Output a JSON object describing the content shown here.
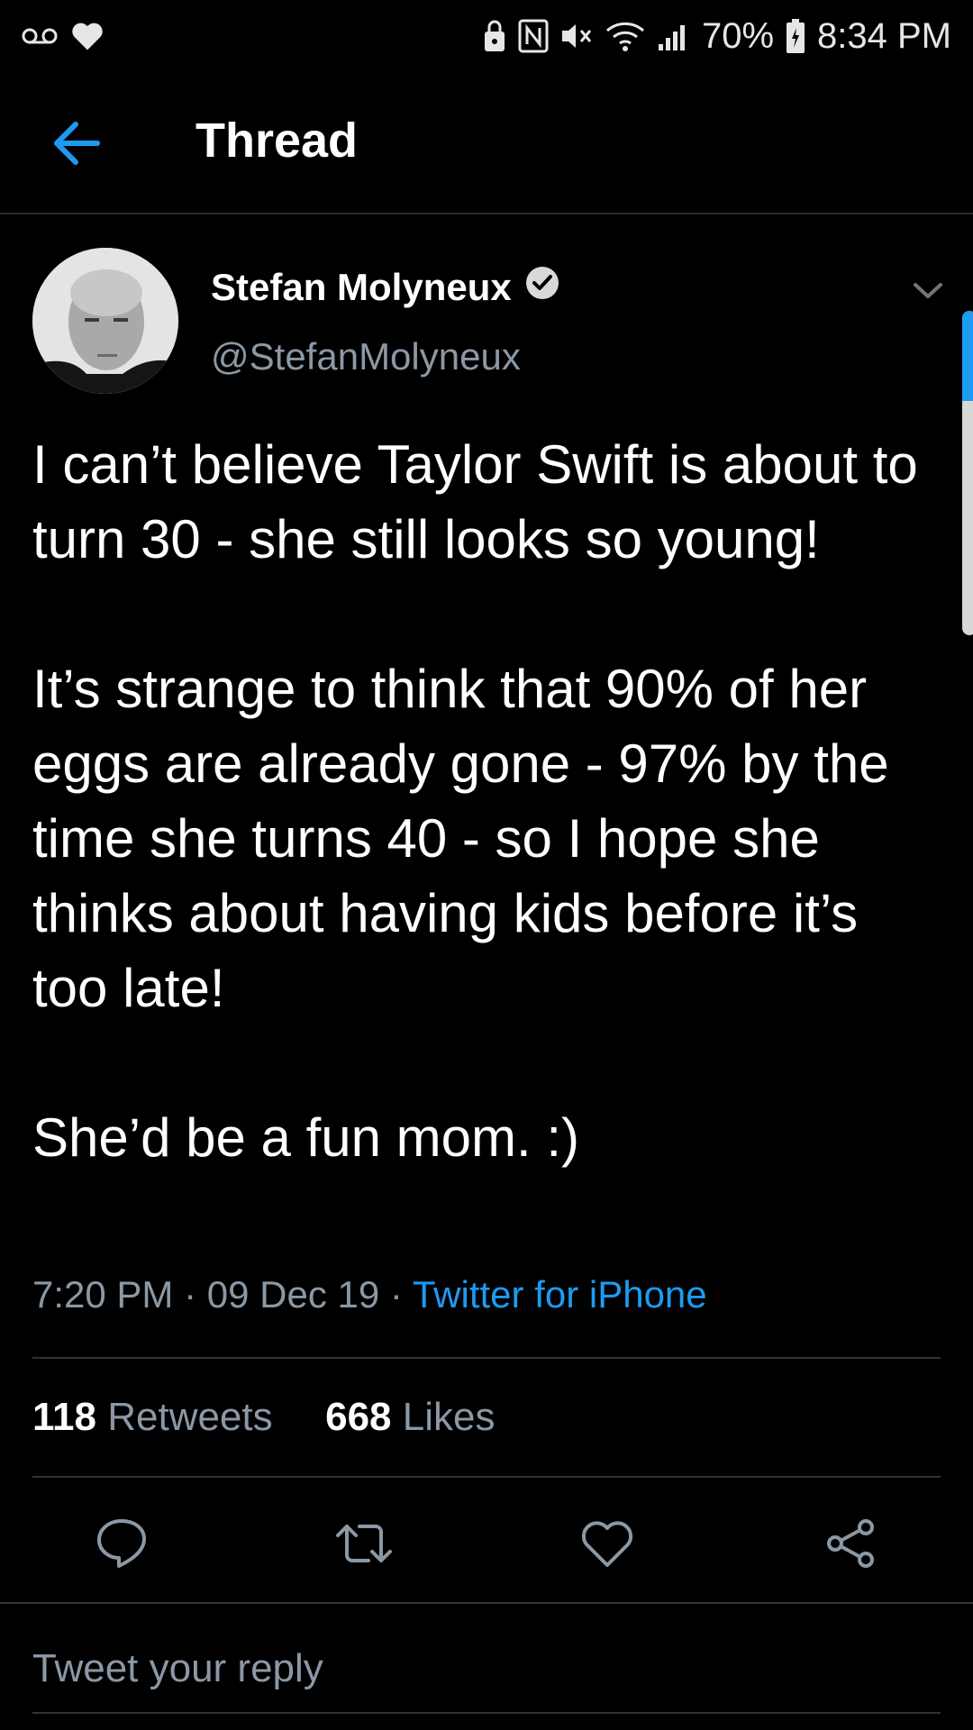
{
  "status_bar": {
    "battery": "70%",
    "time": "8:34 PM",
    "icons_left": [
      "voicemail-icon",
      "heart-icon"
    ],
    "icons_right": [
      "lock-icon",
      "nfc-icon",
      "mute-icon",
      "wifi-icon",
      "signal-icon",
      "battery-icon"
    ]
  },
  "header": {
    "title": "Thread",
    "back_icon": "arrow-left-icon"
  },
  "tweet": {
    "author_name": "Stefan Molyneux",
    "author_handle": "@StefanMolyneux",
    "verified": true,
    "paragraphs": [
      "I can’t believe Taylor Swift is about to turn 30 - she still looks so young!",
      "It’s strange to think that 90% of her eggs are already gone - 97% by the time she turns 40 - so I hope she thinks about having kids before it’s too late!",
      "She’d be a fun mom. :)"
    ],
    "time": "7:20 PM",
    "separator": "·",
    "date": "09 Dec 19",
    "source": "Twitter for iPhone"
  },
  "stats": {
    "retweets_count": "118",
    "retweets_label": "Retweets",
    "likes_count": "668",
    "likes_label": "Likes"
  },
  "actions": [
    "reply-icon",
    "retweet-icon",
    "like-icon",
    "share-icon"
  ],
  "reply": {
    "placeholder": "Tweet your reply"
  },
  "colors": {
    "accent": "#1d9bf0",
    "secondary_text": "#8b98a5",
    "background": "#000000"
  }
}
